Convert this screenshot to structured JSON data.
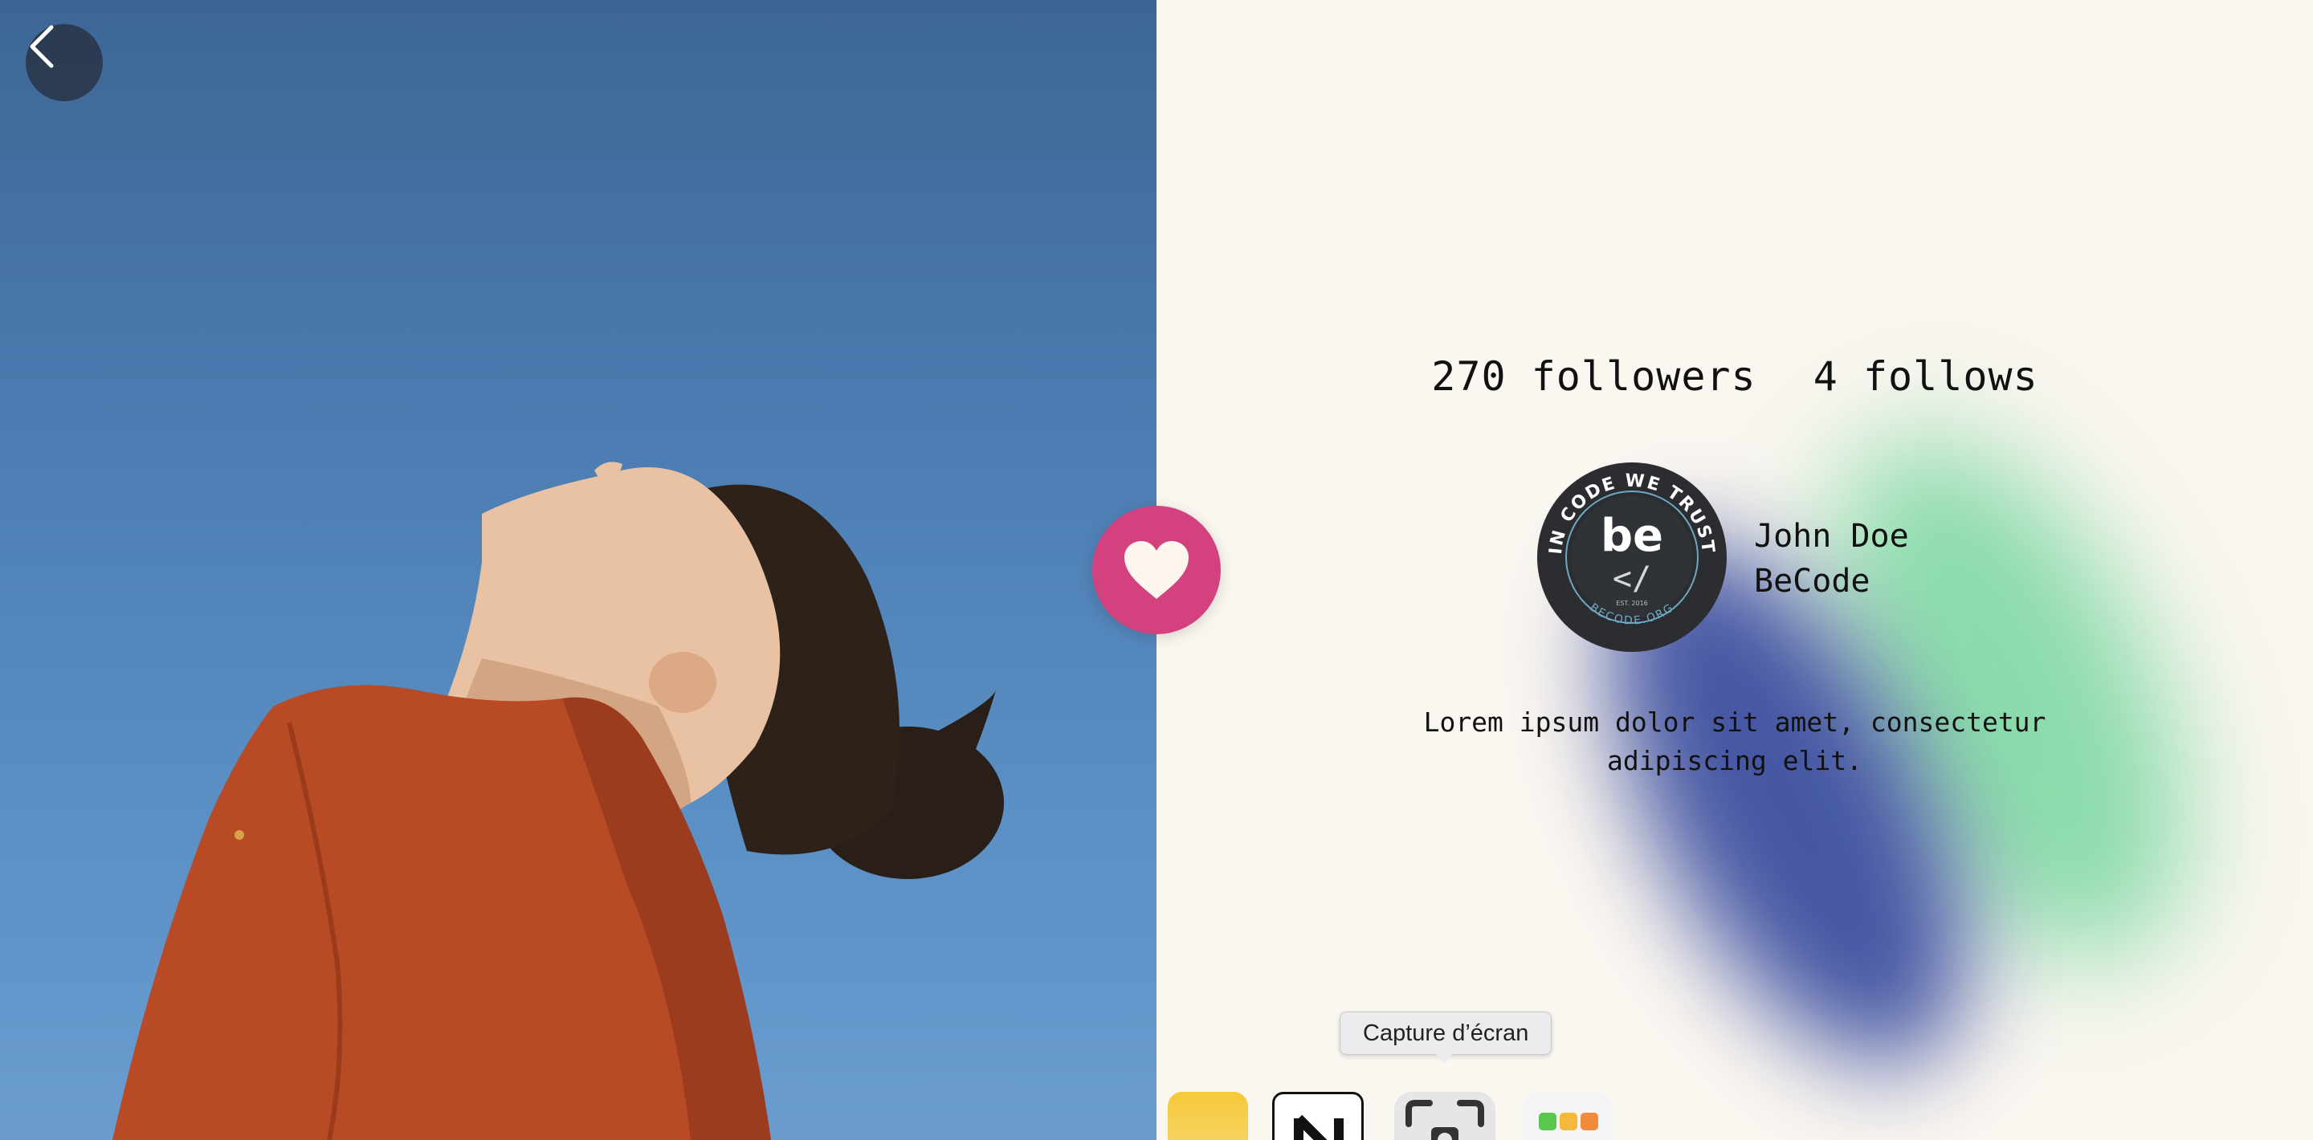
{
  "navigation": {
    "back_icon": "chevron-left-icon"
  },
  "profile": {
    "followers_text": "270 followers",
    "follows_text": "4 follows",
    "name": "John Doe",
    "organization": "BeCode",
    "bio": "Lorem ipsum dolor sit amet, consectetur adipiscing elit.",
    "avatar_logo": {
      "ring_text": "IN CODE WE TRUST",
      "wordmark": "be",
      "glyph": "</",
      "est": "EST. 2016",
      "footer": "BECODE.ORG"
    }
  },
  "like": {
    "icon": "heart-icon",
    "color": "#d4417f"
  },
  "dock": {
    "tooltip": "Capture d’écran",
    "items": [
      "notes-icon",
      "notion-icon",
      "screenshot-icon",
      "launchpad-icon"
    ]
  },
  "colors": {
    "background": "#faf6f0",
    "blob_green": "#6fd49a",
    "blob_blue": "#3c4fa0",
    "sky": "#4a7bb0",
    "jacket": "#b84a26"
  }
}
